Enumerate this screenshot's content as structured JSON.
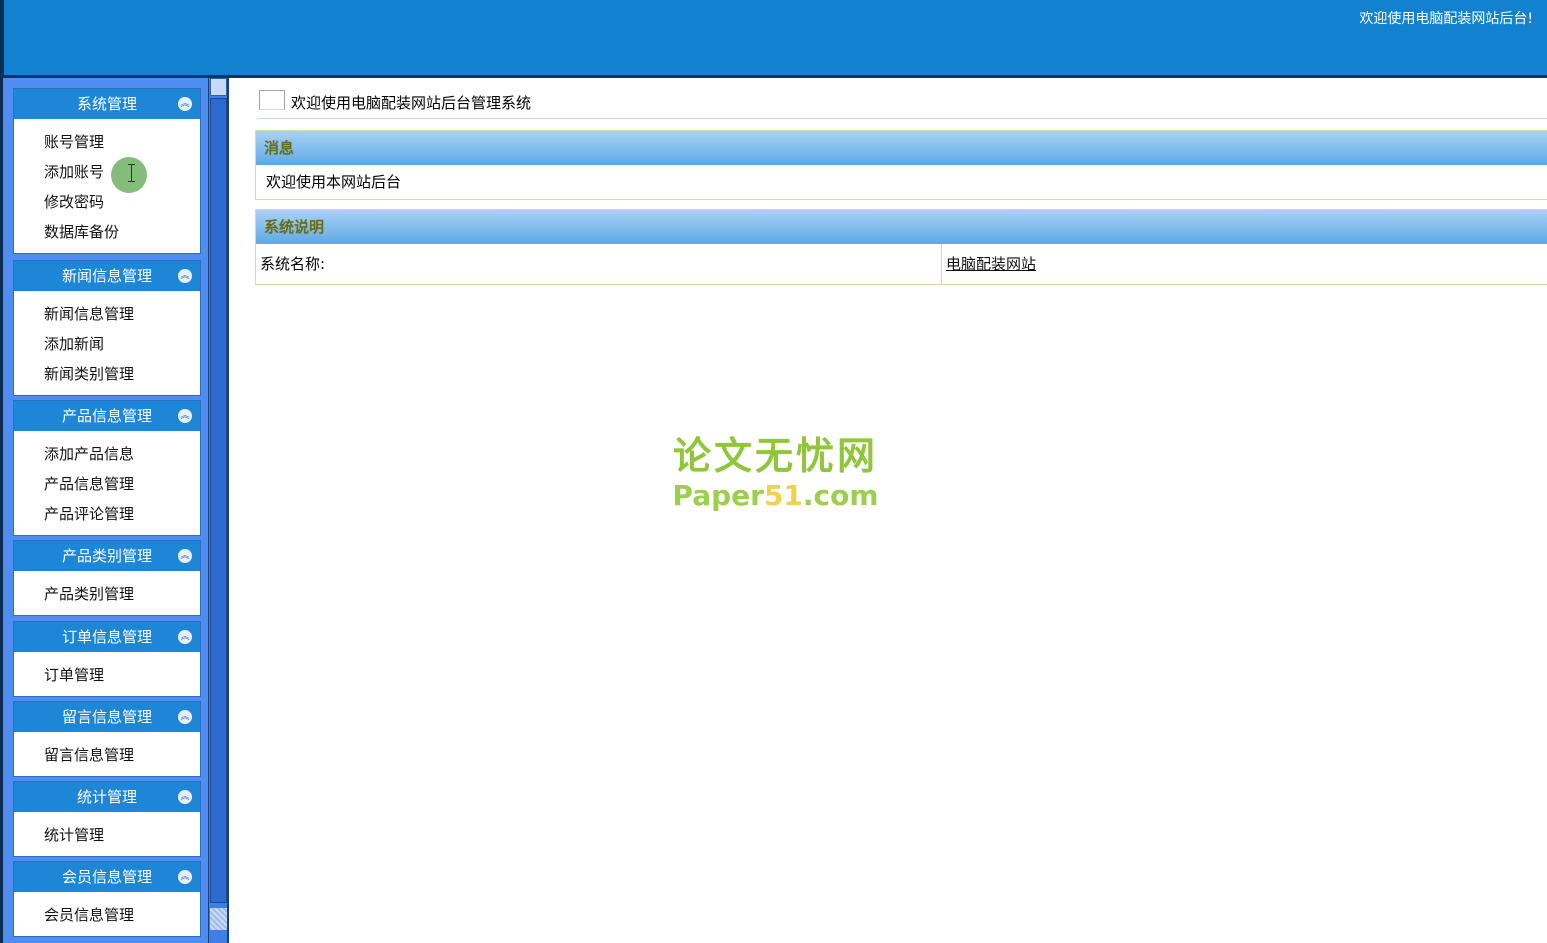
{
  "header": {
    "welcome": "欢迎使用电脑配装网站后台!"
  },
  "sidebar": {
    "groups": [
      {
        "title": "系统管理",
        "items": [
          "账号管理",
          "添加账号",
          "修改密码",
          "数据库备份"
        ]
      },
      {
        "title": "新闻信息管理",
        "items": [
          "新闻信息管理",
          "添加新闻",
          "新闻类别管理"
        ]
      },
      {
        "title": "产品信息管理",
        "items": [
          "添加产品信息",
          "产品信息管理",
          "产品评论管理"
        ]
      },
      {
        "title": "产品类别管理",
        "items": [
          "产品类别管理"
        ]
      },
      {
        "title": "订单信息管理",
        "items": [
          "订单管理"
        ]
      },
      {
        "title": "留言信息管理",
        "items": [
          "留言信息管理"
        ]
      },
      {
        "title": "统计管理",
        "items": [
          "统计管理"
        ]
      },
      {
        "title": "会员信息管理",
        "items": [
          "会员信息管理"
        ]
      }
    ]
  },
  "main": {
    "title": "欢迎使用电脑配装网站后台管理系统",
    "message_panel": {
      "header": "消息",
      "body": "欢迎使用本网站后台"
    },
    "system_panel": {
      "header": "系统说明",
      "label": "系统名称:",
      "value": "电脑配装网站"
    }
  },
  "watermark": {
    "cn": "论文无忧网",
    "en_prefix": "Paper",
    "en_highlight": "51",
    "en_suffix": ".com"
  },
  "colors": {
    "topbar": "#1282d0",
    "sidebar": "#4f8df0",
    "group_header": "#1d86d6",
    "panel_header_text": "#6b6b12"
  },
  "icons": {
    "collapse": "double-chevron-up-icon"
  }
}
